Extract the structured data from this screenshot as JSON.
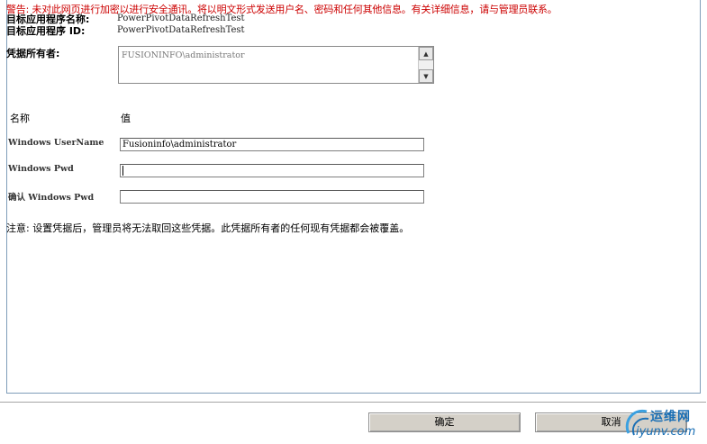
{
  "warning": "警告: 未对此网页进行加密以进行安全通讯。将以明文形式发送用户名、密码和任何其他信息。有关详细信息，请与管理员联系。",
  "app": {
    "name_label": "目标应用程序名称:",
    "name_value": "PowerPivotDataRefreshTest",
    "id_label": "目标应用程序 ID:",
    "id_value": "PowerPivotDataRefreshTest"
  },
  "owners": {
    "label": "凭据所有者:",
    "value": "FUSIONINFO\\administrator"
  },
  "table_header": {
    "name": "名称",
    "value": "值"
  },
  "fields": [
    {
      "label": "Windows UserName",
      "value": "Fusioninfo\\administrator"
    },
    {
      "label": "Windows Pwd",
      "value": ""
    },
    {
      "label": "确认 Windows Pwd",
      "value": ""
    }
  ],
  "note": "注意: 设置凭据后，管理员将无法取回这些凭据。此凭据所有者的任何现有凭据都会被覆盖。",
  "buttons": {
    "ok": "确定",
    "cancel": "取消"
  },
  "watermark": {
    "top": "运维网",
    "bottom": "iyunv.com"
  },
  "colors": {
    "warning": "#cc0000",
    "button_face": "#d4d0c8",
    "panel_border": "#7f9db9"
  }
}
